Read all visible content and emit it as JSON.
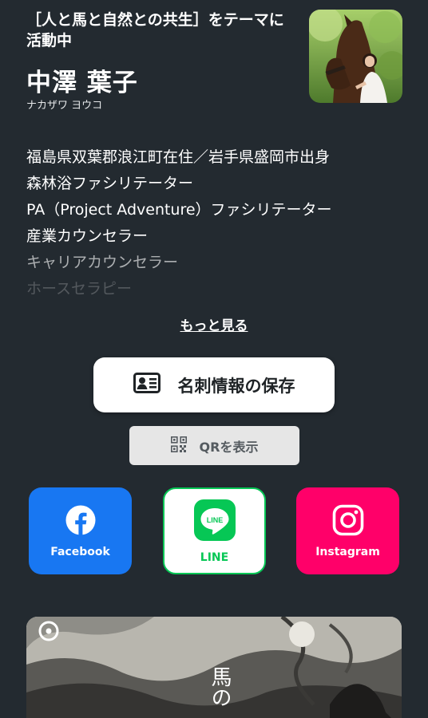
{
  "profile": {
    "tagline": "［人と馬と自然との共生］をテーマに活動中",
    "name": "中澤 葉子",
    "name_kana": "ナカザワ ヨウコ"
  },
  "bio": {
    "lines": [
      "福島県双葉郡浪江町在住／岩手県盛岡市出身",
      "森林浴ファシリテーター",
      "PA（Project Adventure）ファシリテーター",
      "産業カウンセラー",
      "キャリアカウンセラー",
      "ホースセラピー"
    ],
    "more_label": "もっと見る"
  },
  "actions": {
    "save_contact_label": "名刺情報の保存",
    "show_qr_label": "QRを表示"
  },
  "social": {
    "facebook_label": "Facebook",
    "line_label": "LINE",
    "line_icon_text": "LINE",
    "instagram_label": "Instagram"
  },
  "banner": {
    "title_text": "馬の"
  },
  "colors": {
    "background": "#232a30",
    "facebook": "#1877f2",
    "line": "#06c755",
    "instagram": "#ff0069"
  }
}
